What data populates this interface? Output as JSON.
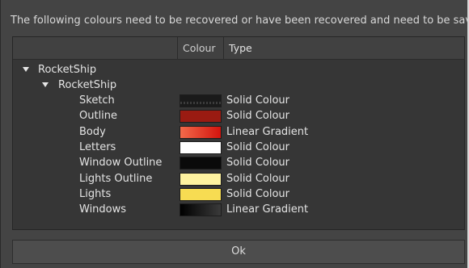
{
  "dialog": {
    "message": "The following colours need to be recovered or have been recovered and need to be saved.",
    "ok_label": "Ok"
  },
  "columns": {
    "name": "",
    "colour": "Colour",
    "type": "Type"
  },
  "tree": {
    "root": "RocketShip",
    "palette": "RocketShip",
    "items": [
      {
        "name": "Sketch",
        "type": "Solid Colour",
        "swatch": {
          "kind": "solid",
          "colors": [
            "#1a1a1a"
          ],
          "pattern": "dotted"
        }
      },
      {
        "name": "Outline",
        "type": "Solid Colour",
        "swatch": {
          "kind": "solid",
          "colors": [
            "#9a1b12"
          ]
        }
      },
      {
        "name": "Body",
        "type": "Linear Gradient",
        "swatch": {
          "kind": "gradient",
          "colors": [
            "#f26a4a",
            "#d4140e"
          ]
        }
      },
      {
        "name": "Letters",
        "type": "Solid Colour",
        "swatch": {
          "kind": "solid",
          "colors": [
            "#ffffff"
          ]
        }
      },
      {
        "name": "Window Outline",
        "type": "Solid Colour",
        "swatch": {
          "kind": "solid",
          "colors": [
            "#0a0a0a"
          ]
        }
      },
      {
        "name": "Lights Outline",
        "type": "Solid Colour",
        "swatch": {
          "kind": "solid",
          "colors": [
            "#fff3a0"
          ]
        }
      },
      {
        "name": "Lights",
        "type": "Solid Colour",
        "swatch": {
          "kind": "solid",
          "colors": [
            "#f7dc52"
          ]
        }
      },
      {
        "name": "Windows",
        "type": "Linear Gradient",
        "swatch": {
          "kind": "gradient",
          "colors": [
            "#000000",
            "#3a3a3a"
          ]
        }
      }
    ]
  }
}
